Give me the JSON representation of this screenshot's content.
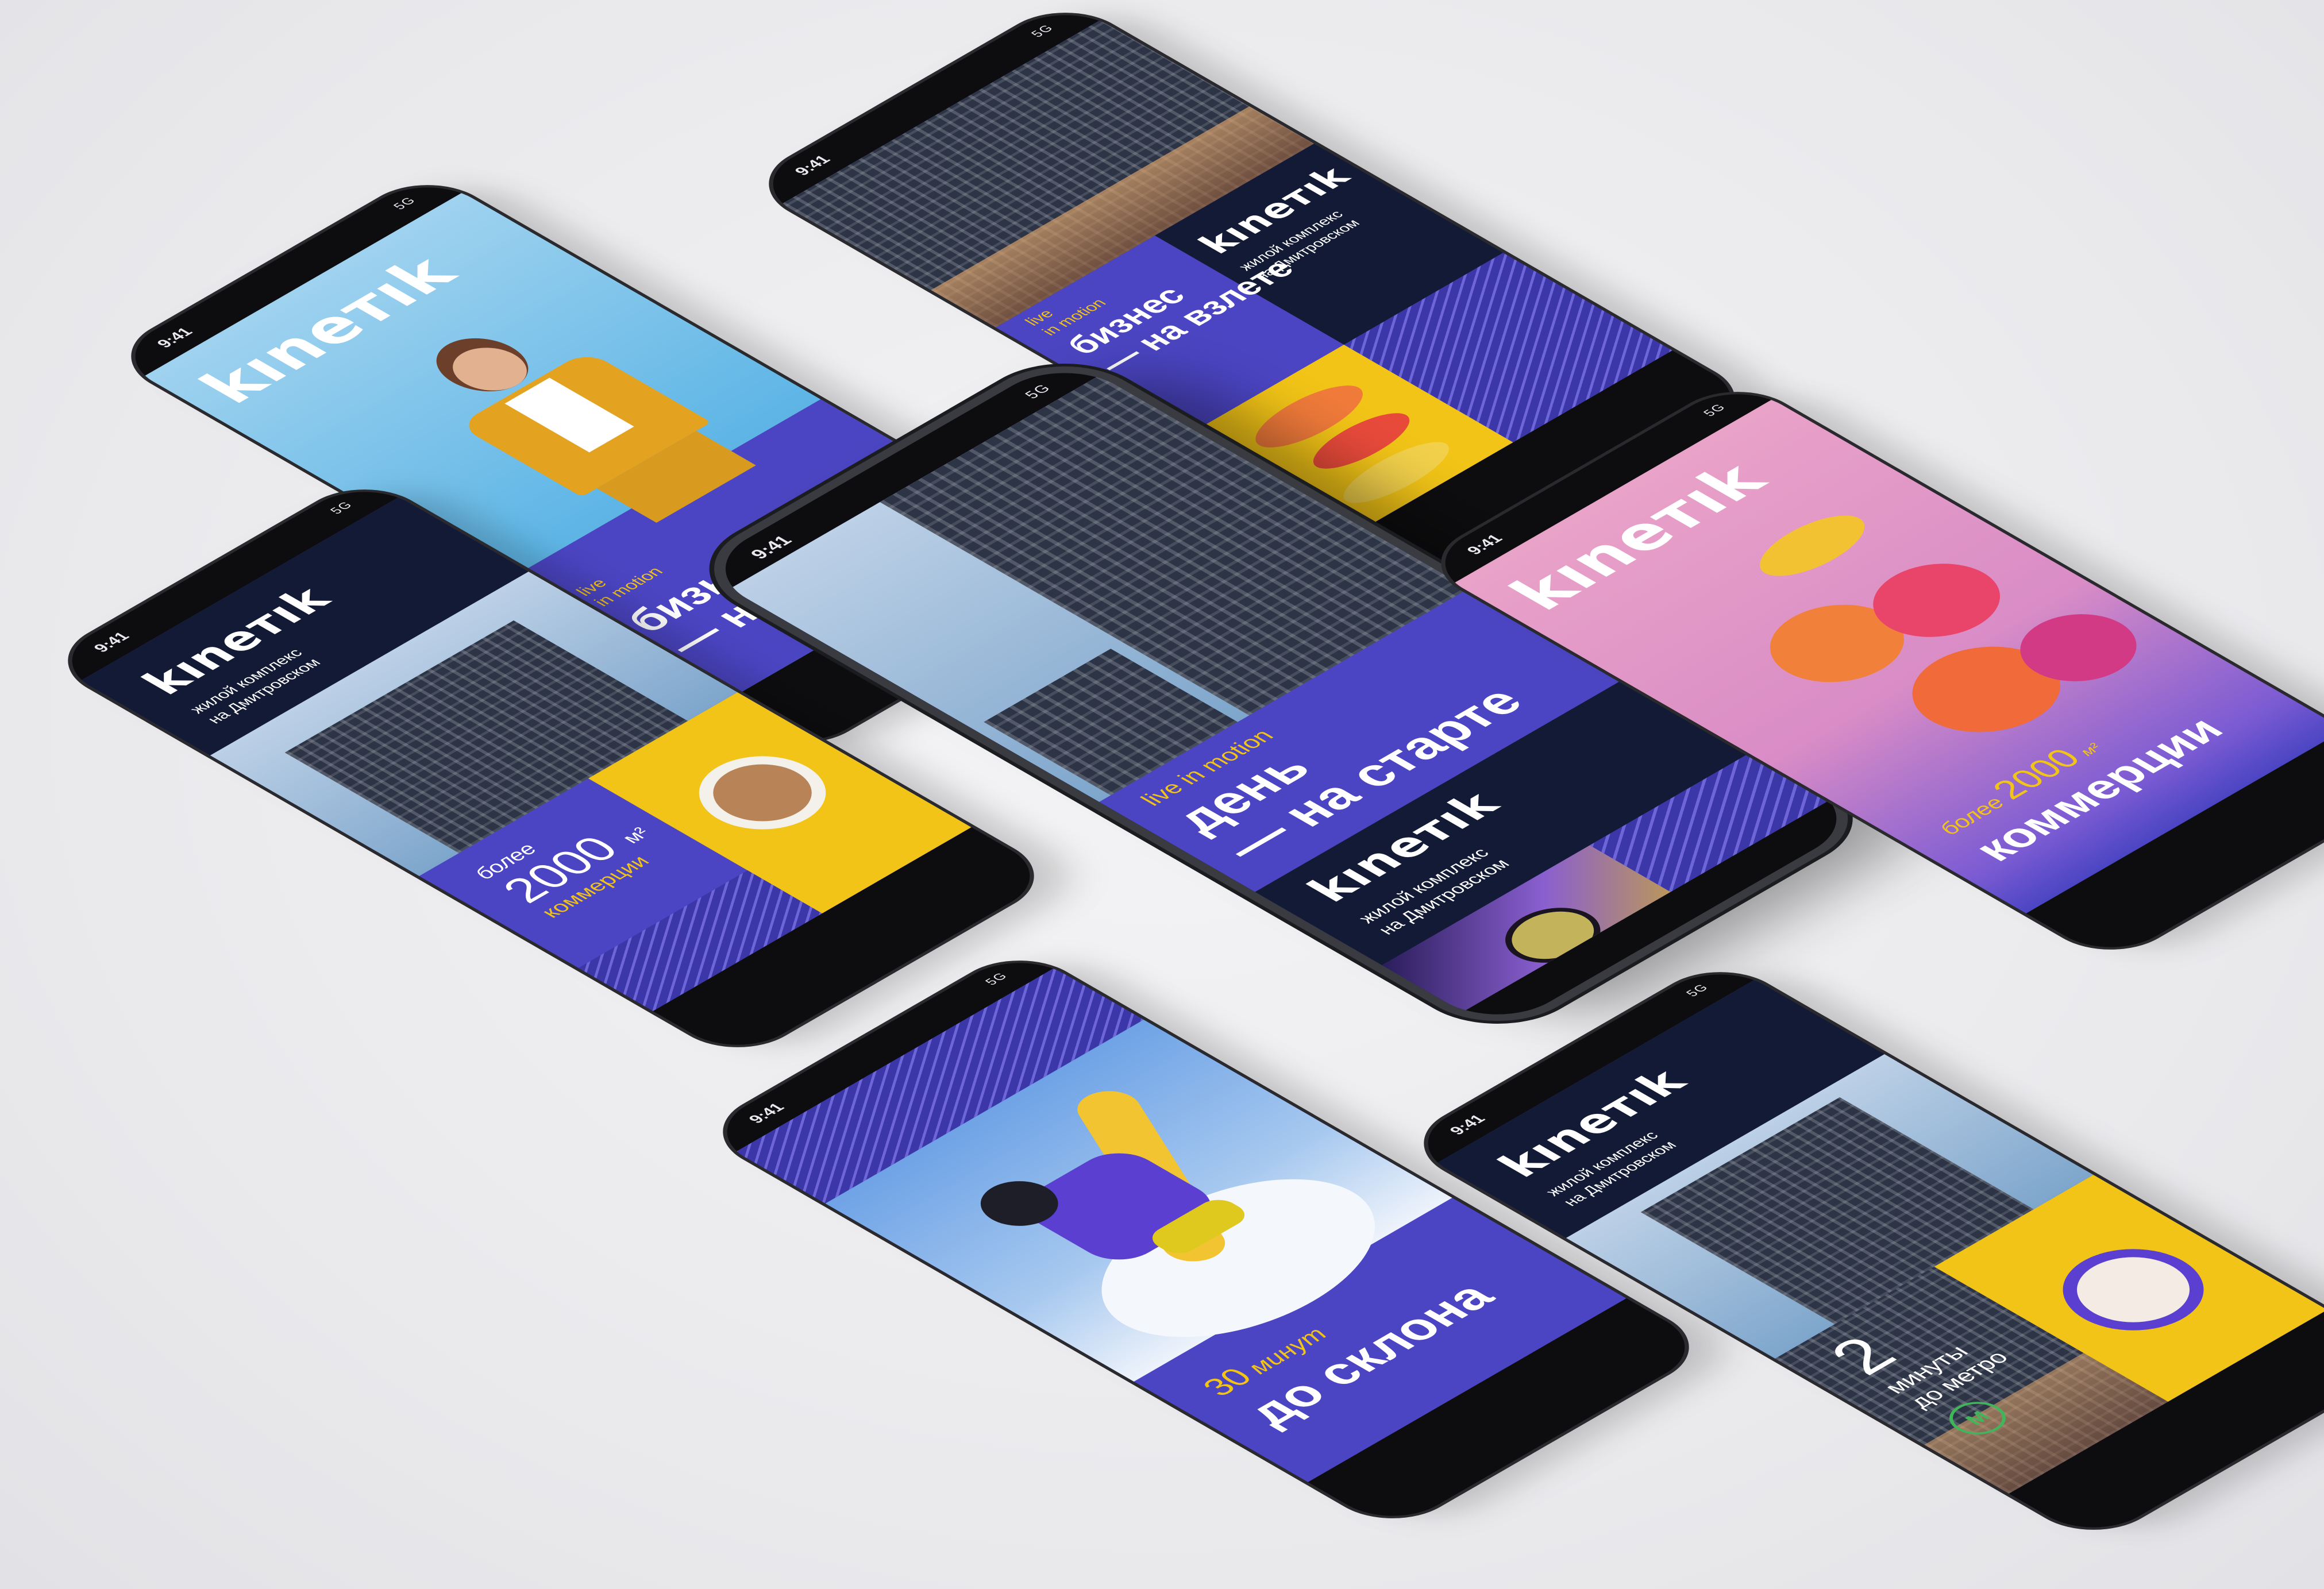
{
  "status_bar": {
    "time": "9:41",
    "signal": "5G"
  },
  "brand": {
    "logo": "kıneтık",
    "tagline_line1": "жилой комплекс",
    "tagline_line2": "на Дмитровском"
  },
  "colors": {
    "purple": "#4b45c3",
    "navy": "#121a35",
    "yellow": "#f2c417",
    "pink": "#e9a2c8",
    "metro_green": "#3fb65a"
  },
  "screens": [
    {
      "id": "business-portrait",
      "logo": "kıneтık",
      "headline_line1": "бизнес",
      "headline_line2": "— на взлете",
      "accent_line1": "live",
      "accent_line2": "in motion"
    },
    {
      "id": "business-macarons",
      "logo": "kıneтık",
      "tagline_line1": "жилой комплекс",
      "tagline_line2": "на Дмитровском",
      "headline_line1": "бизнес",
      "headline_line2": "— на взлете",
      "accent_line1": "live",
      "accent_line2": "in motion"
    },
    {
      "id": "coffee-commerce",
      "logo": "kıneтık",
      "tagline_line1": "жилой комплекс",
      "tagline_line2": "на Дмитровском",
      "lead": "более",
      "number": "2000",
      "unit": "м²",
      "accent": "коммерции"
    },
    {
      "id": "day-start",
      "logo": "kıneтık",
      "tagline_line1": "жилой комплекс",
      "tagline_line2": "на Дмитровском",
      "headline_line1": "день",
      "headline_line2": "— на старте",
      "accent": "live in motion"
    },
    {
      "id": "macarons-commerce",
      "logo": "kıneтık",
      "lead": "более",
      "number": "2000",
      "unit": "м²",
      "headline": "коммерции"
    },
    {
      "id": "snowboard",
      "accent_number": "30",
      "accent_word": "минут",
      "headline": "до склона"
    },
    {
      "id": "metro",
      "logo": "kıneтık",
      "tagline_line1": "жилой комплекс",
      "tagline_line2": "на Дмитровском",
      "number": "2",
      "line1": "минуты",
      "line2": "до метро",
      "metro_letter": "М"
    }
  ]
}
